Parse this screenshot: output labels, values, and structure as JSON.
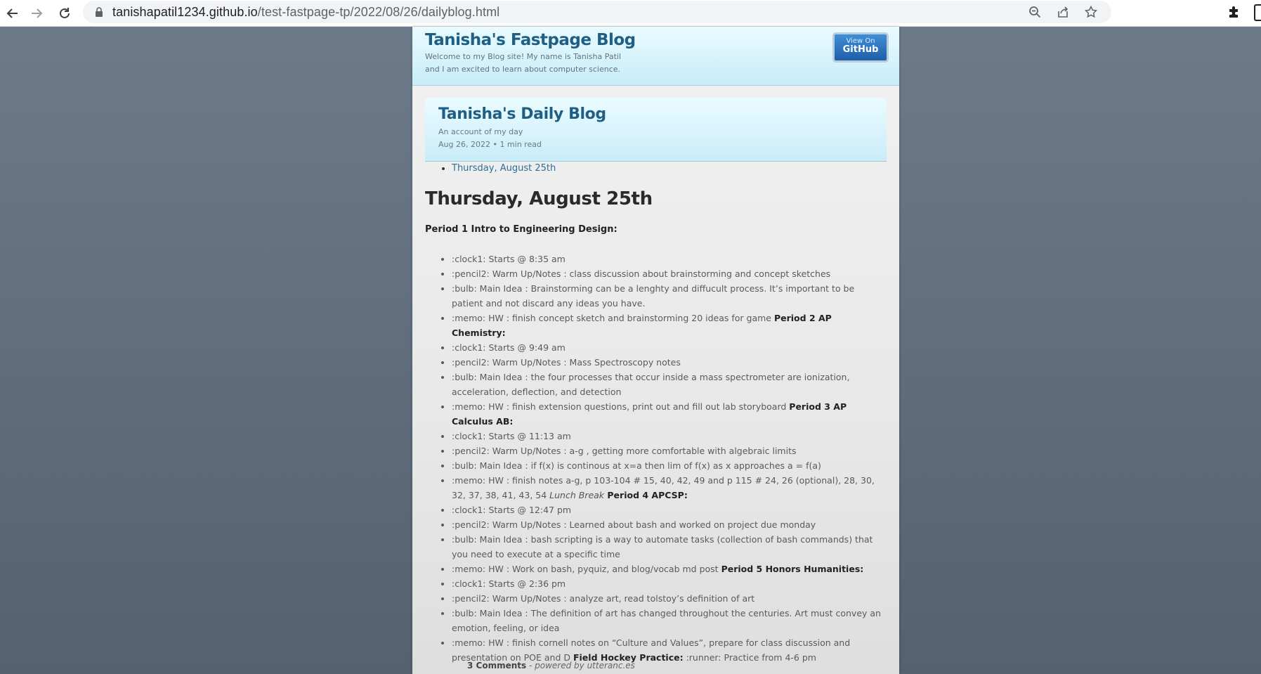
{
  "browser": {
    "url_host": "tanishapatil1234.github.io",
    "url_path": "/test-fastpage-tp/2022/08/26/dailyblog.html",
    "icons": [
      "back-arrow-icon",
      "forward-arrow-icon",
      "reload-icon",
      "lock-icon",
      "zoom-icon",
      "share-icon",
      "star-icon",
      "extensions-icon"
    ]
  },
  "site": {
    "title": "Tanisha's Fastpage Blog",
    "description": "Welcome to my Blog site! My name is Tanisha Patil and I am excited to learn about computer science.",
    "github_small": "View On",
    "github_big": "GitHub"
  },
  "post": {
    "title": "Tanisha's Daily Blog",
    "subtitle": "An account of my day",
    "meta": "Aug 26, 2022 • 1 min read",
    "toc": [
      "Thursday, August 25th"
    ],
    "heading": "Thursday, August 25th",
    "period1": "Period 1 Intro to Engineering Design:"
  },
  "notes": [
    {
      "text": ":clock1: Starts @ 8:35 am"
    },
    {
      "text": ":pencil2: Warm Up/Notes : class discussion about brainstorming and concept sketches"
    },
    {
      "text": ":bulb: Main Idea : Brainstorming can be a lenghty and diffucult process. It’s important to be patient and not discard any ideas you have."
    },
    {
      "text": ":memo: HW : finish concept sketch and brainstorming 20 ideas for game ",
      "bold": "Period 2 AP Chemistry:"
    },
    {
      "text": ":clock1: Starts @ 9:49 am"
    },
    {
      "text": ":pencil2: Warm Up/Notes : Mass Spectroscopy notes"
    },
    {
      "text": ":bulb: Main Idea : the four processes that occur inside a mass spectrometer are ionization, acceleration, deflection, and detection"
    },
    {
      "text": ":memo: HW : finish extension questions, print out and fill out lab storyboard ",
      "bold": "Period 3 AP Calculus AB:"
    },
    {
      "text": ":clock1: Starts @ 11:13 am"
    },
    {
      "text": ":pencil2: Warm Up/Notes : a-g , getting more comfortable with algebraic limits"
    },
    {
      "text": ":bulb: Main Idea : if f(x) is continous at x=a then lim of f(x) as x approaches a = f(a)"
    },
    {
      "text": ":memo: HW : finish notes a-g, p 103-104 # 15, 40, 42, 49 and p 115 # 24, 26 (optional), 28, 30, 32, 37, 38, 41, 43, 54 ",
      "italic": "Lunch Break",
      "bold": " Period 4 APCSP:"
    },
    {
      "text": ":clock1: Starts @ 12:47 pm"
    },
    {
      "text": ":pencil2: Warm Up/Notes : Learned about bash and worked on project due monday"
    },
    {
      "text": ":bulb: Main Idea : bash scripting is a way to automate tasks (collection of bash commands) that you need to execute at a specific time"
    },
    {
      "text": ":memo: HW : Work on bash, pyquiz, and blog/vocab md post ",
      "bold": "Period 5 Honors Humanities:"
    },
    {
      "text": ":clock1: Starts @ 2:36 pm"
    },
    {
      "text": ":pencil2: Warm Up/Notes : analyze art, read tolstoy’s definition of art"
    },
    {
      "text": ":bulb: Main Idea : The definition of art has changed throughout the centuries. Art must convey an emotion, feeling, or idea"
    },
    {
      "text": ":memo: HW : finish cornell notes on “Culture and Values”, prepare for class discussion and presentation on POE and D ",
      "bold": "Field Hockey Practice:",
      "after": " :runner: Practice from 4-6 pm"
    }
  ],
  "comments": {
    "count": "3 Comments",
    "powered": "- powered by utteranc.es"
  }
}
